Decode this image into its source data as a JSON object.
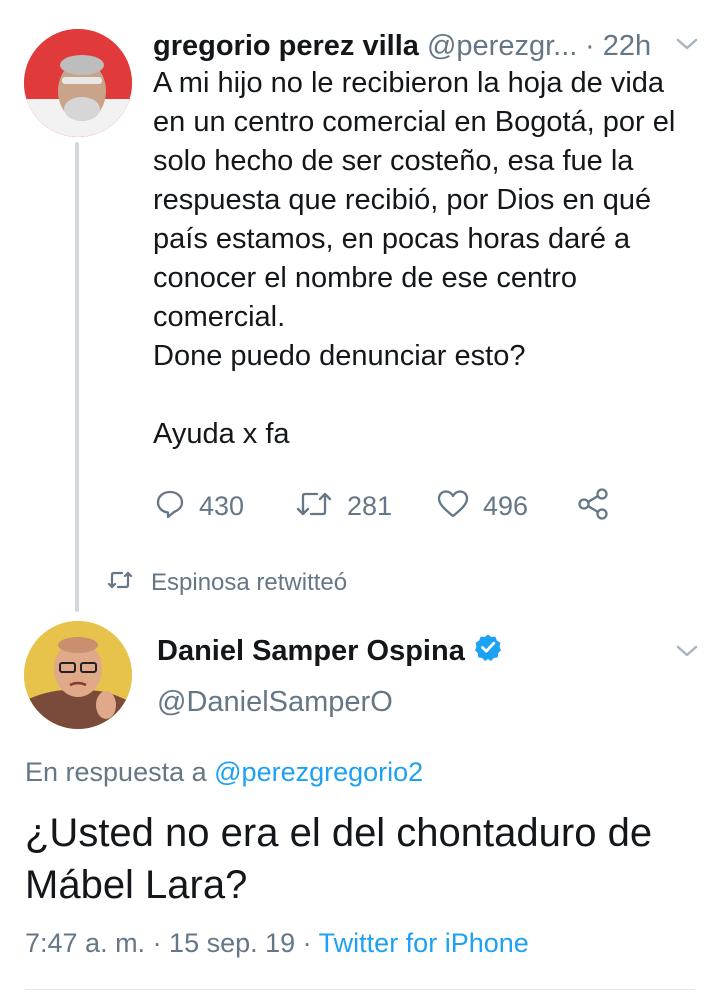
{
  "tweet1": {
    "author_name": "gregorio perez villa",
    "author_handle": "@perezgr...",
    "time": "· 22h",
    "body_lines": [
      "A mi hijo no le recibieron la hoja de vida",
      "en un centro comercial en Bogotá, por el",
      "solo hecho de ser costeño, esa fue la",
      "respuesta que recibió, por Dios en qué",
      "país estamos, en pocas horas daré a",
      "conocer el nombre de ese centro",
      "comercial.",
      "Done puedo denunciar esto?",
      "Ayuda x fa"
    ],
    "replies": "430",
    "retweets": "281",
    "likes": "496"
  },
  "retweet_notice": "Espinosa retwitteó",
  "tweet2": {
    "author_name": "Daniel Samper Ospina",
    "author_handle": "@DanielSamperO",
    "reply_to_prefix": "En respuesta a",
    "reply_to_mention": "@perezgregorio2",
    "body": "¿Usted no era el del chontaduro de Mábel Lara?",
    "time": "7:47 a. m. · 15 sep. 19 ·",
    "source": "Twitter for iPhone"
  },
  "colors": {
    "primary_text": "#14171a",
    "secondary_text": "#657786",
    "link": "#1da1f2",
    "thread_line": "#cfd8dd"
  },
  "icons": [
    "chevron-down-icon",
    "reply-icon",
    "retweet-icon",
    "like-icon",
    "share-icon",
    "verified-badge-icon"
  ]
}
